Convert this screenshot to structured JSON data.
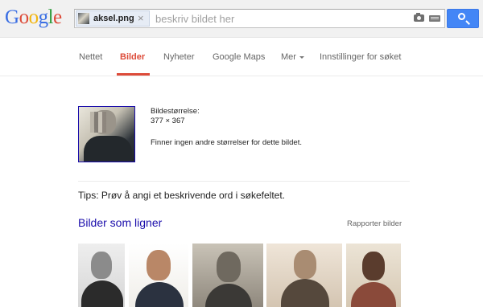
{
  "header": {
    "logo_text": "Google",
    "chip_filename": "aksel.png",
    "chip_close": "×",
    "search_placeholder": "beskriv bildet her",
    "icons": [
      "camera-icon",
      "keyboard-icon",
      "search-icon"
    ],
    "accent_color": "#4386f6"
  },
  "tabs": [
    {
      "label": "Nettet",
      "active": false
    },
    {
      "label": "Bilder",
      "active": true
    },
    {
      "label": "Nyheter",
      "active": false
    },
    {
      "label": "Google Maps",
      "active": false
    },
    {
      "label": "Mer",
      "active": false
    },
    {
      "label": "Innstillinger for søket",
      "active": false
    }
  ],
  "active_tab_color": "#dd4b39",
  "result": {
    "size_label": "Bildestørrelse:",
    "size_value": "377 × 367",
    "no_other_sizes": "Finner ingen andre størrelser for dette bildet.",
    "tips": "Tips: Prøv å angi et beskrivende ord i søkefeltet.",
    "similar_title": "Bilder som ligner",
    "report_link": "Rapporter bilder"
  }
}
